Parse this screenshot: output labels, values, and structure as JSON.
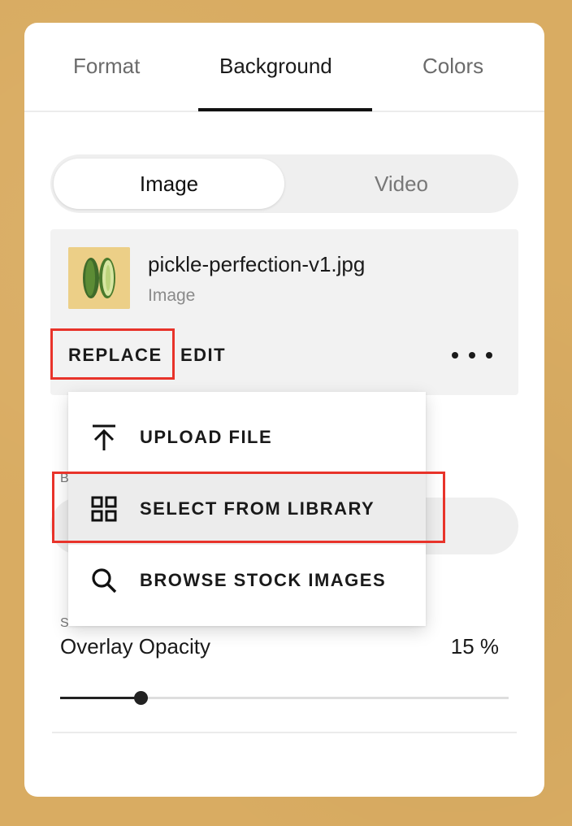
{
  "tabs": [
    {
      "label": "Format",
      "active": false
    },
    {
      "label": "Background",
      "active": true
    },
    {
      "label": "Colors",
      "active": false
    }
  ],
  "media_toggle": {
    "image_label": "Image",
    "video_label": "Video",
    "selected": "Image"
  },
  "file": {
    "name": "pickle-perfection-v1.jpg",
    "type": "Image",
    "thumbnail_icon": "pickle-thumbnail"
  },
  "file_actions": {
    "replace_label": "REPLACE",
    "edit_label": "EDIT",
    "more_icon": "more-horizontal-icon"
  },
  "replace_menu": {
    "items": [
      {
        "label": "UPLOAD FILE",
        "icon": "upload-icon"
      },
      {
        "label": "SELECT FROM LIBRARY",
        "icon": "grid-icon",
        "hovered": true
      },
      {
        "label": "BROWSE STOCK IMAGES",
        "icon": "search-icon"
      }
    ]
  },
  "partial_labels": {
    "first": "B",
    "second": "S"
  },
  "overlay": {
    "label": "Overlay Opacity",
    "value_text": "15 %",
    "value": 15,
    "max": 100
  },
  "colors": {
    "highlight": "#e8332a",
    "page_bg": "#d9ac62",
    "thumb_bg": "#eccf87"
  }
}
